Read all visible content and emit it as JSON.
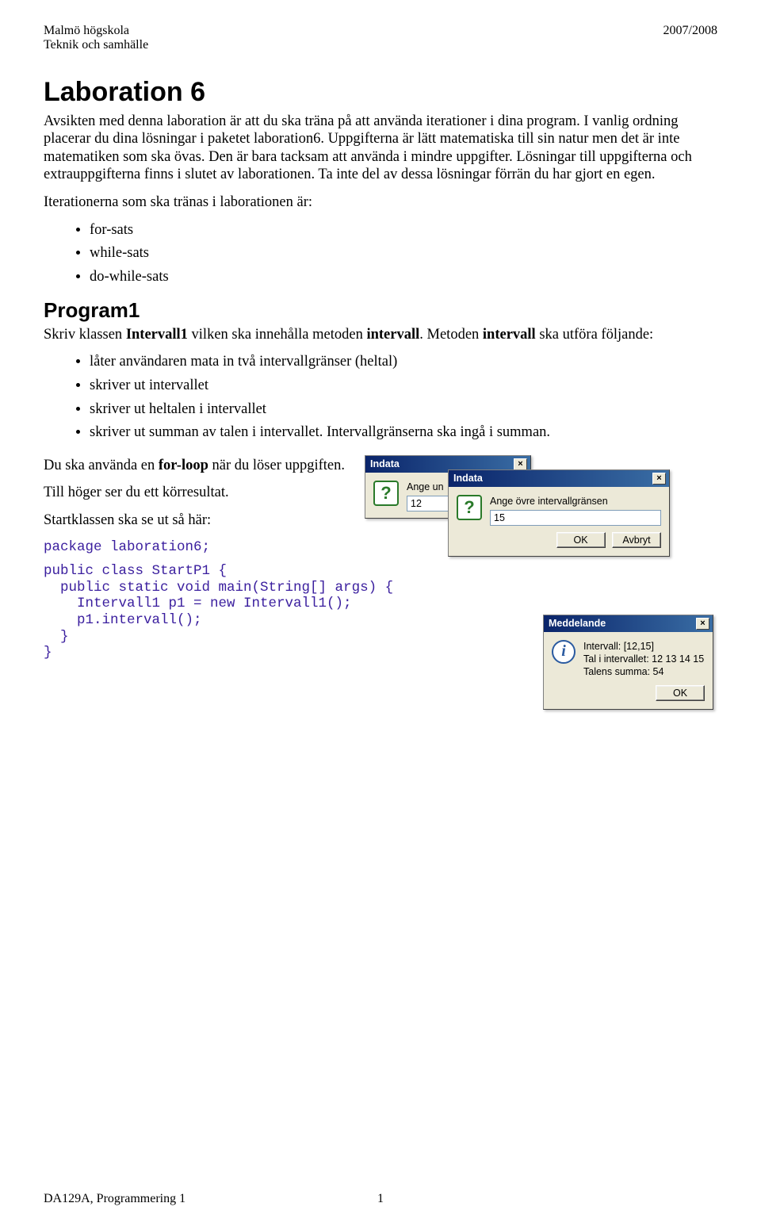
{
  "header": {
    "left_line1": "Malmö högskola",
    "left_line2": "Teknik och samhälle",
    "right_line1": "2007/2008"
  },
  "title": "Laboration 6",
  "intro": {
    "p1": "Avsikten med denna laboration är att du ska träna på att använda iterationer i dina program. I vanlig ordning placerar du dina lösningar i paketet laboration6. Uppgifterna är lätt matematiska till sin natur men det är inte matematiken som ska övas. Den är bara tacksam att använda i mindre uppgifter. Lösningar till uppgifterna och extrauppgifterna finns i slutet av laborationen. Ta inte del av dessa lösningar förrän du har gjort en egen.",
    "p2": "Iterationerna som ska tränas i laborationen är:"
  },
  "iterations": [
    "for-sats",
    "while-sats",
    "do-while-sats"
  ],
  "program1_heading": "Program1",
  "program1_p1_pre": "Skriv klassen ",
  "program1_p1_b1": "Intervall1",
  "program1_p1_mid": " vilken ska innehålla metoden ",
  "program1_p1_b2": "intervall",
  "program1_p1_post": ". Metoden ",
  "program1_p1_b3": "intervall",
  "program1_p1_tail": " ska utföra följande:",
  "program1_list": [
    "låter användaren mata in två intervallgränser (heltal)",
    "skriver ut intervallet",
    "skriver ut heltalen i intervallet",
    "skriver ut summan av talen i intervallet. Intervallgränserna ska ingå i summan."
  ],
  "p_forloop_pre": "Du ska använda en ",
  "p_forloop_b": "for-loop",
  "p_forloop_post": " när du löser uppgiften.",
  "p_tillhoger": "Till höger ser du ett körresultat.",
  "p_startklass": "Startklassen ska se ut så här:",
  "code_line1": "package laboration6;",
  "code_block": "public class StartP1 {\n  public static void main(String[] args) {\n    Intervall1 p1 = new Intervall1();\n    p1.intervall();\n  }\n}",
  "dialogs": {
    "d1": {
      "title": "Indata",
      "prompt": "Ange un",
      "value": "12"
    },
    "d2": {
      "title": "Indata",
      "prompt": "Ange övre intervallgränsen",
      "value": "15"
    },
    "ok": "OK",
    "cancel": "Avbryt",
    "d3": {
      "title": "Meddelande",
      "line1": "Intervall: [12,15]",
      "line2": "Tal i intervallet: 12 13 14 15",
      "line3": "Talens summa: 54"
    }
  },
  "footer": {
    "left": "DA129A, Programmering 1",
    "center": "1"
  }
}
